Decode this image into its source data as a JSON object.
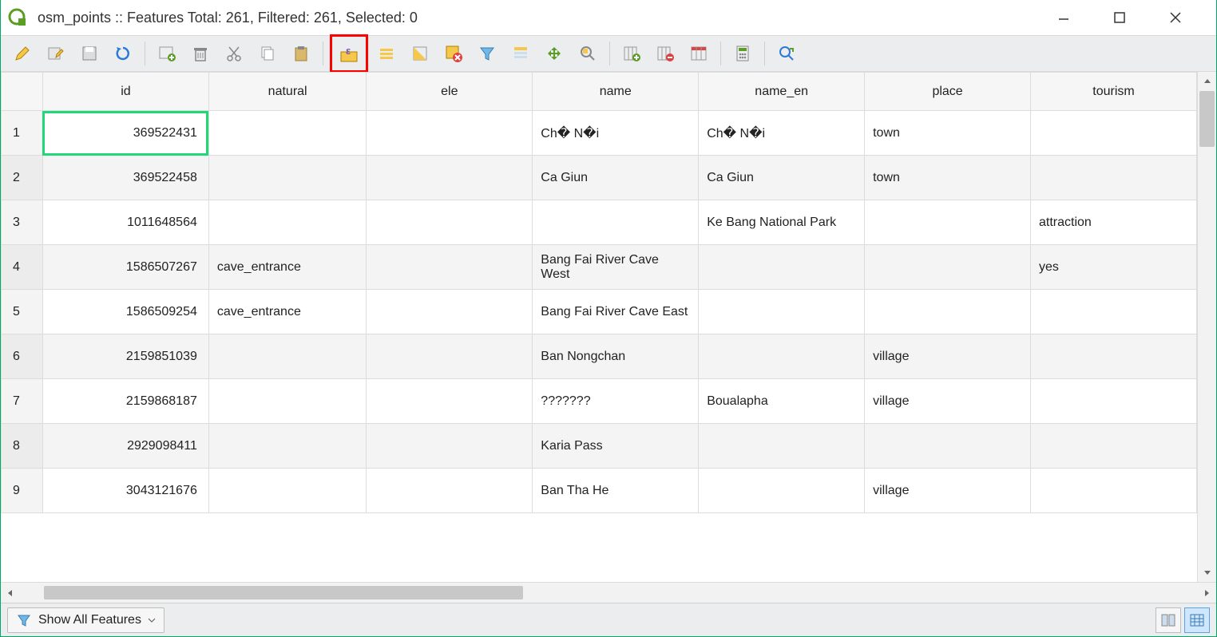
{
  "title": "osm_points :: Features Total: 261, Filtered: 261, Selected: 0",
  "columns": [
    "id",
    "natural",
    "ele",
    "name",
    "name_en",
    "place",
    "tourism"
  ],
  "rows": [
    {
      "n": "1",
      "id": "369522431",
      "natural": "",
      "ele": "",
      "name": "Ch� N�i",
      "name_en": "Ch� N�i",
      "place": "town",
      "tourism": ""
    },
    {
      "n": "2",
      "id": "369522458",
      "natural": "",
      "ele": "",
      "name": "Ca Giun",
      "name_en": "Ca Giun",
      "place": "town",
      "tourism": ""
    },
    {
      "n": "3",
      "id": "1011648564",
      "natural": "",
      "ele": "",
      "name": "",
      "name_en": "Ke Bang National Park",
      "place": "",
      "tourism": "attraction"
    },
    {
      "n": "4",
      "id": "1586507267",
      "natural": "cave_entrance",
      "ele": "",
      "name": "Bang Fai River Cave West",
      "name_en": "",
      "place": "",
      "tourism": "yes"
    },
    {
      "n": "5",
      "id": "1586509254",
      "natural": "cave_entrance",
      "ele": "",
      "name": "Bang Fai River Cave East",
      "name_en": "",
      "place": "",
      "tourism": ""
    },
    {
      "n": "6",
      "id": "2159851039",
      "natural": "",
      "ele": "",
      "name": "Ban Nongchan",
      "name_en": "",
      "place": "village",
      "tourism": ""
    },
    {
      "n": "7",
      "id": "2159868187",
      "natural": "",
      "ele": "",
      "name": "???????",
      "name_en": "Boualapha",
      "place": "village",
      "tourism": ""
    },
    {
      "n": "8",
      "id": "2929098411",
      "natural": "",
      "ele": "",
      "name": "Karia Pass",
      "name_en": "",
      "place": "",
      "tourism": ""
    },
    {
      "n": "9",
      "id": "3043121676",
      "natural": "",
      "ele": "",
      "name": "Ban Tha He",
      "name_en": "",
      "place": "village",
      "tourism": ""
    }
  ],
  "filter_label": "Show All Features",
  "toolbar_icons": [
    "edit-pencil",
    "multi-edit",
    "save",
    "reload",
    "sep",
    "add-feature",
    "delete",
    "cut",
    "copy",
    "paste",
    "sep",
    "expression-select",
    "select-all",
    "invert-select",
    "deselect",
    "filter",
    "field-calc",
    "move",
    "zoom",
    "sep",
    "new-field",
    "delete-field",
    "organize",
    "sep",
    "conditional-format",
    "sep",
    "actions"
  ]
}
